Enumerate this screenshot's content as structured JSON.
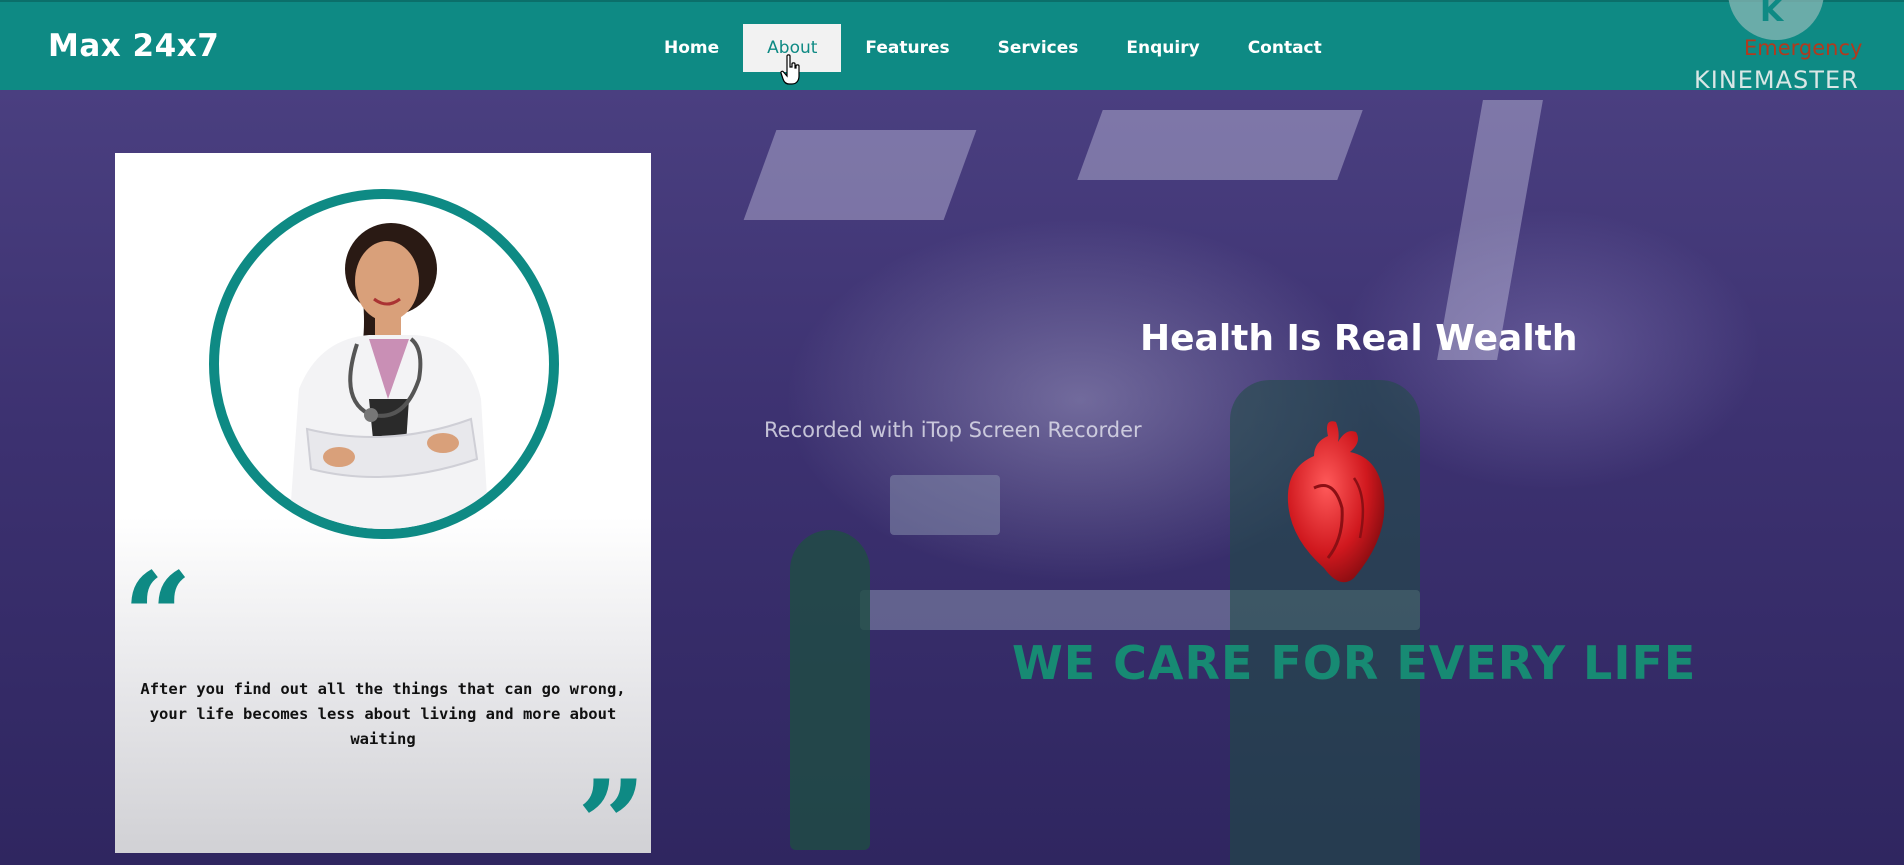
{
  "header": {
    "brand": "Max 24x7",
    "nav": [
      {
        "label": "Home",
        "active": false
      },
      {
        "label": "About",
        "active": true
      },
      {
        "label": "Features",
        "active": false
      },
      {
        "label": "Services",
        "active": false
      },
      {
        "label": "Enquiry",
        "active": false
      },
      {
        "label": "Contact",
        "active": false
      }
    ]
  },
  "watermark": {
    "emergency": "Emergency",
    "kinemaster": "KINEMASTER",
    "logo_letter": "K"
  },
  "card": {
    "quote_open": "“",
    "quote_close": "”",
    "quote_line1": "After you find out all the things that can go wrong,",
    "quote_line2": "your life becomes less about living and more about waiting"
  },
  "hero": {
    "recorder_note": "Recorded with iTop Screen Recorder",
    "title": "Health Is Real Wealth",
    "tagline": "WE CARE FOR EVERY LIFE"
  },
  "colors": {
    "primary": "#0e8a84",
    "tagline": "#178a73",
    "emergency": "#b23a1e"
  },
  "icons": [
    "hand-cursor-icon",
    "heart-icon",
    "doctor-photo"
  ]
}
